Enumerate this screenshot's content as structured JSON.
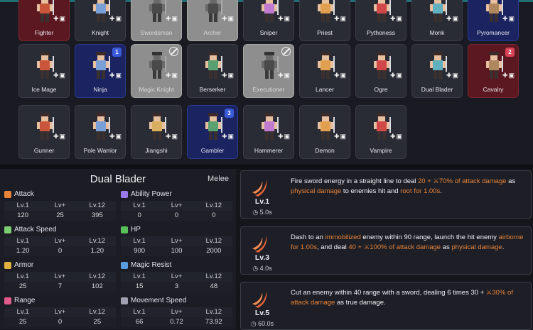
{
  "roster": {
    "row1": [
      {
        "name": "Fighter",
        "state": "red"
      },
      {
        "name": "Knight",
        "state": "normal"
      },
      {
        "name": "Swordsman",
        "state": "locked"
      },
      {
        "name": "Archer",
        "state": "locked"
      },
      {
        "name": "Sniper",
        "state": "normal"
      },
      {
        "name": "Priest",
        "state": "normal"
      },
      {
        "name": "Pythoness",
        "state": "normal"
      },
      {
        "name": "Monk",
        "state": "normal"
      },
      {
        "name": "Pyromancer",
        "state": "selected"
      }
    ],
    "row2": [
      {
        "name": "Ice Mage",
        "state": "normal"
      },
      {
        "name": "Ninja",
        "state": "selected",
        "badge": "1"
      },
      {
        "name": "Magic Knight",
        "state": "locked"
      },
      {
        "name": "Berserker",
        "state": "normal"
      },
      {
        "name": "Executioner",
        "state": "locked"
      },
      {
        "name": "Lancer",
        "state": "normal"
      },
      {
        "name": "Ogre",
        "state": "normal"
      },
      {
        "name": "Dual Blader",
        "state": "normal"
      },
      {
        "name": "Cavalry",
        "state": "red",
        "badge": "2"
      }
    ],
    "row3": [
      {
        "name": "Gunner",
        "state": "normal"
      },
      {
        "name": "Pole Warrior",
        "state": "normal"
      },
      {
        "name": "Jiangshi",
        "state": "normal"
      },
      {
        "name": "Gambler",
        "state": "selected",
        "badge": "3"
      },
      {
        "name": "Hammerer",
        "state": "normal"
      },
      {
        "name": "Demon",
        "state": "normal"
      },
      {
        "name": "Vampire",
        "state": "normal"
      }
    ]
  },
  "selected_unit": {
    "name": "Dual Blader",
    "type": "Melee",
    "col_headers": [
      "Lv.1",
      "Lv+",
      "Lv.12"
    ],
    "stats": [
      {
        "label": "Attack",
        "icon": "sword-icon",
        "values": [
          "120",
          "25",
          "395"
        ]
      },
      {
        "label": "Ability Power",
        "icon": "wand-icon",
        "values": [
          "0",
          "0",
          "0"
        ]
      },
      {
        "label": "Attack Speed",
        "icon": "speed-icon",
        "values": [
          "1.20",
          "0",
          "1.20"
        ]
      },
      {
        "label": "HP",
        "icon": "plus-icon",
        "values": [
          "900",
          "100",
          "2000"
        ]
      },
      {
        "label": "Armor",
        "icon": "armor-icon",
        "values": [
          "25",
          "7",
          "102"
        ]
      },
      {
        "label": "Magic Resist",
        "icon": "orb-icon",
        "values": [
          "15",
          "3",
          "48"
        ]
      },
      {
        "label": "Range",
        "icon": "range-icon",
        "values": [
          "25",
          "0",
          "25"
        ]
      },
      {
        "label": "Movement Speed",
        "icon": "boot-icon",
        "values": [
          "66",
          "0.72",
          "73.92"
        ]
      }
    ]
  },
  "skills": [
    {
      "level": "Lv.1",
      "cooldown": "5.0s",
      "parts": [
        {
          "t": "Fire sword energy in a straight line to deal ",
          "c": "w"
        },
        {
          "t": "20 + ⚔70% of attack damage",
          "c": "o"
        },
        {
          "t": " as ",
          "c": "w"
        },
        {
          "t": "physical damage",
          "c": "o"
        },
        {
          "t": " to enemies hit and ",
          "c": "w"
        },
        {
          "t": "root for 1.00s",
          "c": "o"
        },
        {
          "t": ".",
          "c": "w"
        }
      ]
    },
    {
      "level": "Lv.3",
      "cooldown": "4.0s",
      "parts": [
        {
          "t": "Dash to an ",
          "c": "w"
        },
        {
          "t": "immobilized",
          "c": "o"
        },
        {
          "t": " enemy within 90 range, launch the hit enemy ",
          "c": "w"
        },
        {
          "t": "airborne for 1.00s",
          "c": "o"
        },
        {
          "t": ", and deal ",
          "c": "w"
        },
        {
          "t": "40 + ⚔100% of attack damage",
          "c": "o"
        },
        {
          "t": " as ",
          "c": "w"
        },
        {
          "t": "physical damage",
          "c": "o"
        },
        {
          "t": ".",
          "c": "w"
        }
      ]
    },
    {
      "level": "Lv.5",
      "cooldown": "60.0s",
      "parts": [
        {
          "t": "Cut an enemy within 40 range with a sword, dealing 6 times 30 + ",
          "c": "w"
        },
        {
          "t": "⚔30% of attack damage",
          "c": "o"
        },
        {
          "t": " as true damage.",
          "c": "w"
        }
      ]
    }
  ],
  "colors": {
    "accent_orange": "#e8843a",
    "selected_blue": "#1b2360",
    "locked_gray": "#8e8e8e",
    "red_card": "#5c1820"
  }
}
